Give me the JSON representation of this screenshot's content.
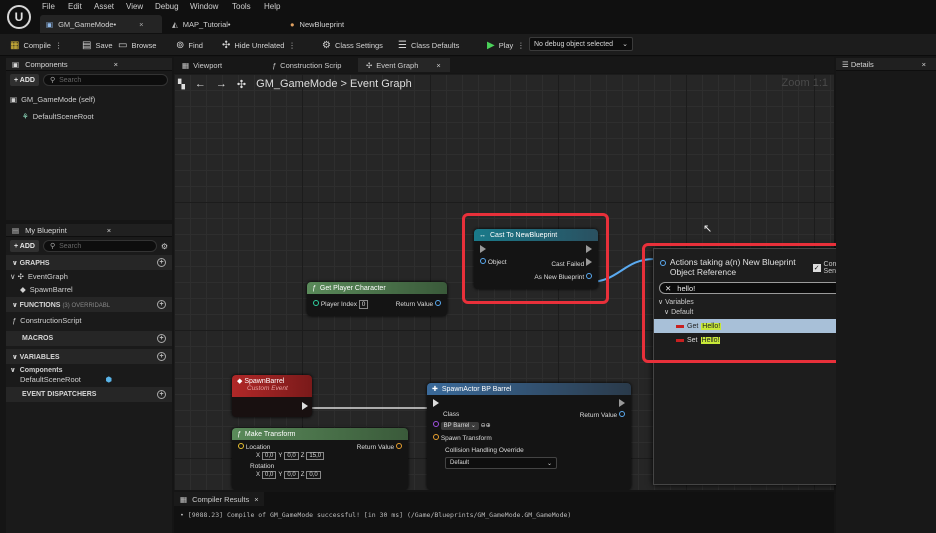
{
  "menu": [
    "File",
    "Edit",
    "Asset",
    "View",
    "Debug",
    "Window",
    "Tools",
    "Help"
  ],
  "doc_tabs": [
    {
      "label": "GM_GameMode•"
    },
    {
      "label": "MAP_Tutorial•"
    },
    {
      "label": "NewBlueprint"
    }
  ],
  "toolbar": {
    "compile": "Compile",
    "save": "Save",
    "browse": "Browse",
    "find": "Find",
    "hide_unrelated": "Hide Unrelated",
    "class_settings": "Class Settings",
    "class_defaults": "Class Defaults",
    "play": "Play",
    "debug_select": "No debug object selected"
  },
  "components": {
    "title": "Components",
    "add": "+ ADD",
    "search": "Search",
    "self": "GM_GameMode (self)",
    "root": "DefaultSceneRoot"
  },
  "my_blueprint": {
    "title": "My Blueprint",
    "add": "+ ADD",
    "search": "Search",
    "graphs": "GRAPHS",
    "event_graph": "EventGraph",
    "spawn_barrel": "SpawnBarrel",
    "functions": "FUNCTIONS",
    "functions_count": "(3) OVERRIDABL",
    "construction": "ConstructionScript",
    "macros": "MACROS",
    "variables": "VARIABLES",
    "components_cat": "Components",
    "var_root": "DefaultSceneRoot",
    "dispatchers": "EVENT DISPATCHERS"
  },
  "graph_tabs": {
    "viewport": "Viewport",
    "construction": "Construction Scrip",
    "event_graph": "Event Graph"
  },
  "breadcrumb": {
    "root": "GM_GameMode",
    "sep": ">",
    "current": "Event Graph"
  },
  "zoom": "Zoom 1:1",
  "nodes": {
    "cast": {
      "title": "Cast To NewBlueprint",
      "object": "Object",
      "failed": "Cast Failed",
      "as": "As New Blueprint"
    },
    "getplayer": {
      "title": "Get Player Character",
      "index_label": "Player Index",
      "index_val": "0",
      "ret": "Return Value"
    },
    "spawnevent": {
      "title": "SpawnBarrel",
      "sub": "Custom Event"
    },
    "spawnactor": {
      "title": "SpawnActor BP Barrel",
      "class": "Class",
      "class_val": "BP Barrel",
      "ret": "Return Value",
      "transform": "Spawn Transform",
      "collision": "Collision Handling Override",
      "collision_val": "Default"
    },
    "maketransform": {
      "title": "Make Transform",
      "location": "Location",
      "ret": "Return Value",
      "x": "0,0",
      "y": "0,0",
      "z": "15,0",
      "rotation": "Rotation",
      "rx": "0,0",
      "ry": "0,0",
      "rz": "0,0"
    }
  },
  "context_menu": {
    "title_line1": "Actions taking a(n) New Blueprint",
    "title_line2": "Object Reference",
    "context_sensitive": "Context Sensitive",
    "search_value": "hello!",
    "cat_variables": "Variables",
    "cat_default": "Default",
    "item_get": "Get",
    "item_set": "Set",
    "highlight": "Hello!"
  },
  "compiler": {
    "tab": "Compiler Results",
    "message": "• [9088.23] Compile of GM_GameMode successful! [in 30 ms] (/Game/Blueprints/GM_GameMode.GM_GameMode)"
  },
  "details": {
    "title": "Details"
  }
}
